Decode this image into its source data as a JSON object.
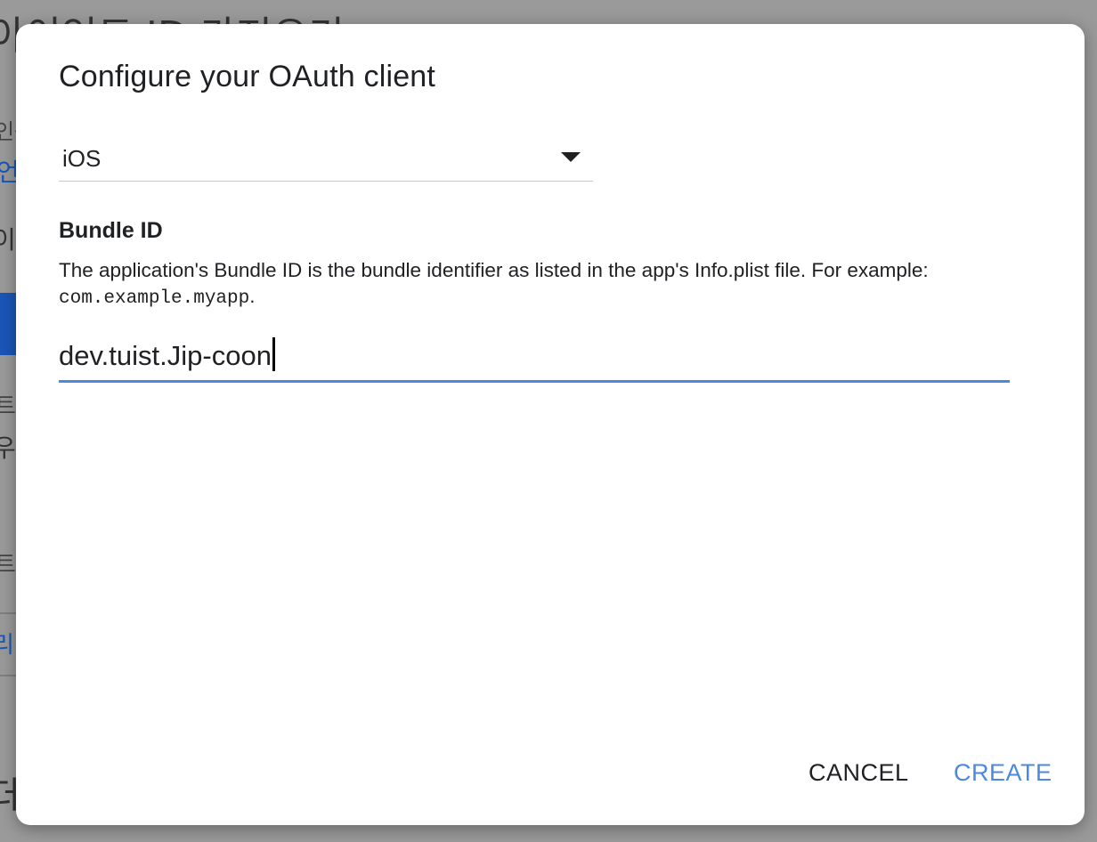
{
  "background": {
    "title_fragment": "아이언트 ID 가져오기",
    "line1": "인증",
    "line2": "언",
    "line3": "이",
    "line4": "트",
    "line5": "우",
    "line5_right": "!",
    "line6": "트",
    "line7": "리",
    "line8": "데"
  },
  "dialog": {
    "title": "Configure your OAuth client",
    "app_type": {
      "selected": "iOS"
    },
    "bundle_id": {
      "label": "Bundle ID",
      "help_text": "The application's Bundle ID is the bundle identifier as listed in the app's Info.plist file. For example: ",
      "help_example": "com.example.myapp",
      "help_suffix": ".",
      "value": "dev.tuist.Jip-coon"
    },
    "actions": {
      "cancel_label": "CANCEL",
      "create_label": "CREATE"
    }
  },
  "colors": {
    "accent": "#4a89dc",
    "backdrop": "#9a9a9a",
    "text": "#202124"
  }
}
